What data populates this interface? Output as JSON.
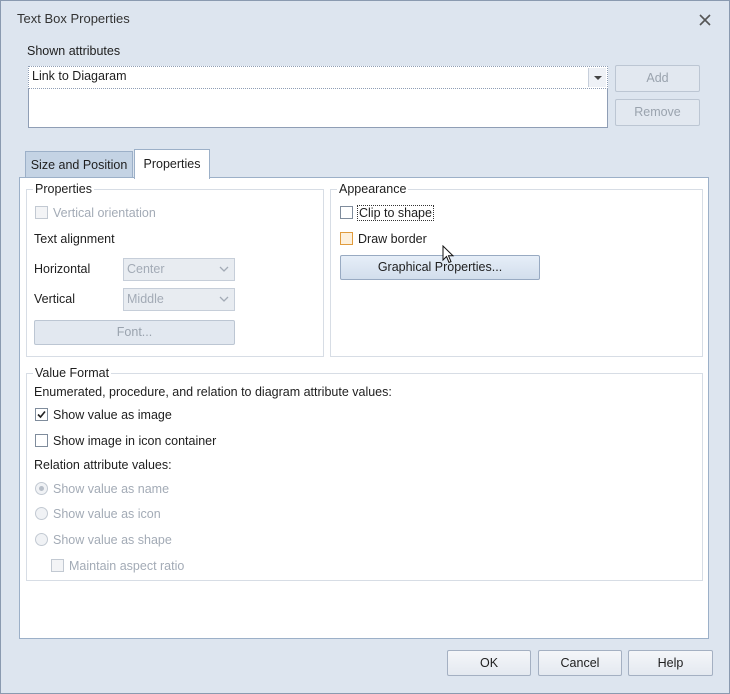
{
  "window": {
    "title": "Text Box Properties"
  },
  "shown_attributes": {
    "label": "Shown attributes",
    "selected": "Link to Diagaram",
    "add_label": "Add",
    "remove_label": "Remove"
  },
  "tabs": [
    {
      "label": "Size and Position",
      "active": false
    },
    {
      "label": "Properties",
      "active": true
    }
  ],
  "properties_group": {
    "title": "Properties",
    "vertical_orientation": "Vertical orientation",
    "text_alignment": "Text alignment",
    "horizontal_label": "Horizontal",
    "horizontal_value": "Center",
    "vertical_label": "Vertical",
    "vertical_value": "Middle",
    "font_button": "Font..."
  },
  "appearance_group": {
    "title": "Appearance",
    "clip_to_shape": "Clip to shape",
    "draw_border": "Draw border",
    "graphical_properties": "Graphical Properties..."
  },
  "value_format": {
    "title": "Value Format",
    "enum_label": "Enumerated, procedure, and relation to diagram attribute values:",
    "show_value_as_image": "Show value as image",
    "show_value_as_image_checked": true,
    "show_image_in_icon_container": "Show image in icon container",
    "relation_label": "Relation attribute values:",
    "show_value_as_name": "Show value as name",
    "show_value_as_icon": "Show value as icon",
    "show_value_as_shape": "Show value as shape",
    "maintain_aspect_ratio": "Maintain aspect ratio"
  },
  "footer": {
    "ok": "OK",
    "cancel": "Cancel",
    "help": "Help"
  },
  "colors": {
    "dialog_bg": "#dde5ef",
    "tab_inactive": "#c4d3e4",
    "hover_checkbox": "#e09b3c"
  }
}
